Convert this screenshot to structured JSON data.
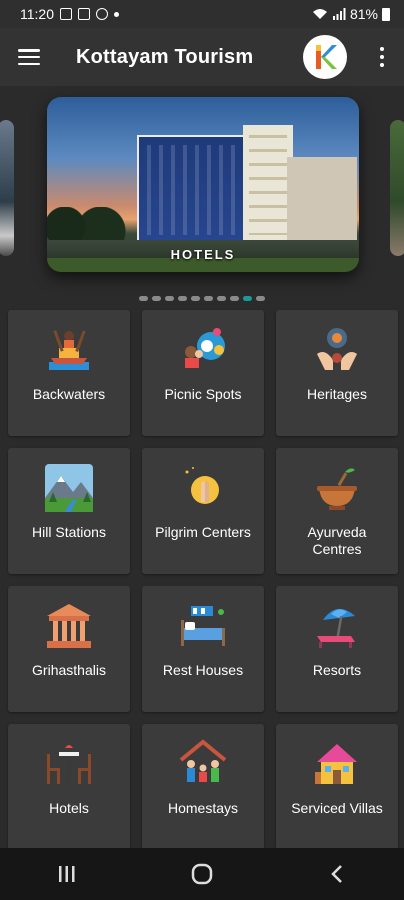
{
  "status_bar": {
    "time": "11:20",
    "battery": "81%"
  },
  "app_bar": {
    "title": "Kottayam Tourism",
    "logo_letter": "K"
  },
  "carousel": {
    "slide_label": "HOTELS",
    "page_count": 10,
    "active_index": 8
  },
  "categories": [
    {
      "label": "Backwaters",
      "icon": "boat-icon"
    },
    {
      "label": "Picnic Spots",
      "icon": "picnic-icon"
    },
    {
      "label": "Heritages",
      "icon": "heritage-icon"
    },
    {
      "label": "Hill Stations",
      "icon": "mountain-icon"
    },
    {
      "label": "Pilgrim Centers",
      "icon": "praying-hands-icon"
    },
    {
      "label": "Ayurveda\nCentres",
      "icon": "mortar-pestle-icon"
    },
    {
      "label": "Grihasthalis",
      "icon": "pillars-icon"
    },
    {
      "label": "Rest Houses",
      "icon": "bed-icon"
    },
    {
      "label": "Resorts",
      "icon": "beach-umbrella-icon"
    },
    {
      "label": "Hotels",
      "icon": "dining-table-icon"
    },
    {
      "label": "Homestays",
      "icon": "family-house-icon"
    },
    {
      "label": "Serviced Villas",
      "icon": "villa-icon"
    }
  ],
  "colors": {
    "background": "#2b2b2b",
    "tile": "#3b3b3b",
    "app_bar": "#333333",
    "active_dot": "#1a9a94"
  }
}
